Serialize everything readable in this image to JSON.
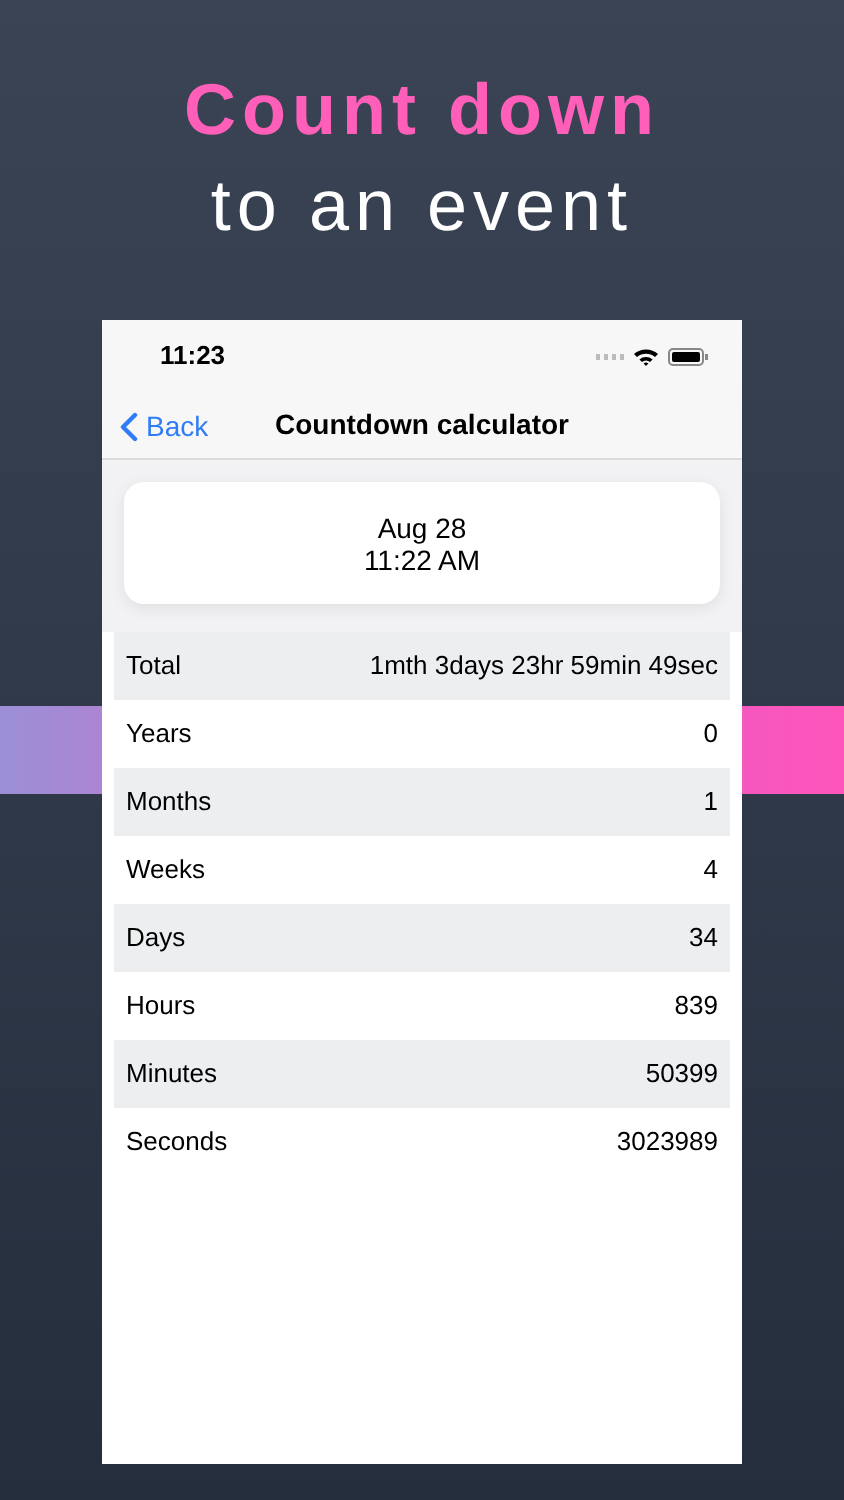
{
  "headline": {
    "accent": "Count down",
    "rest": "to an event"
  },
  "status_bar": {
    "time": "11:23"
  },
  "nav": {
    "back": "Back",
    "title": "Countdown calculator"
  },
  "date_card": {
    "date": "Aug 28",
    "time": "11:22 AM"
  },
  "rows": [
    {
      "label": "Total",
      "value": "1mth 3days 23hr 59min 49sec"
    },
    {
      "label": "Years",
      "value": "0"
    },
    {
      "label": "Months",
      "value": "1"
    },
    {
      "label": "Weeks",
      "value": "4"
    },
    {
      "label": "Days",
      "value": "34"
    },
    {
      "label": "Hours",
      "value": "839"
    },
    {
      "label": "Minutes",
      "value": "50399"
    },
    {
      "label": "Seconds",
      "value": "3023989"
    }
  ]
}
